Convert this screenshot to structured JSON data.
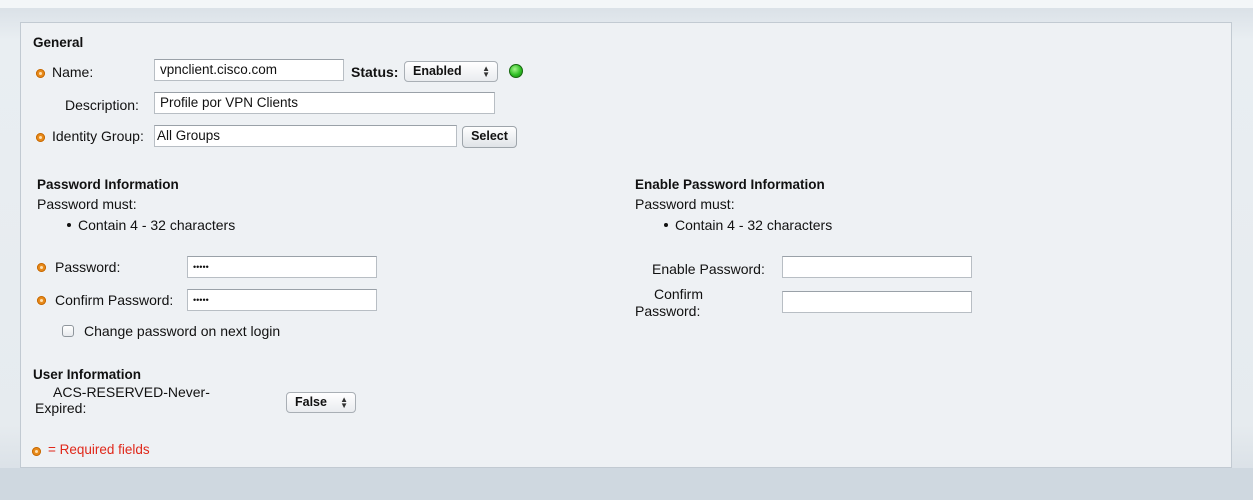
{
  "general": {
    "title": "General",
    "name_label": "Name:",
    "name_value": "vpnclient.cisco.com",
    "status_label": "Status:",
    "status_value": "Enabled",
    "description_label": "Description:",
    "description_value": "Profile por VPN Clients",
    "identity_group_label": "Identity Group:",
    "identity_group_value": "All Groups",
    "select_button": "Select"
  },
  "password_info": {
    "title": "Password Information",
    "must_label": "Password must:",
    "rule": "Contain 4 - 32 characters",
    "password_label": "Password:",
    "password_value": "•••••",
    "confirm_label": "Confirm Password:",
    "confirm_value": "•••••",
    "change_on_login_label": "Change password on next login"
  },
  "enable_password_info": {
    "title": "Enable Password Information",
    "must_label": "Password must:",
    "rule": "Contain 4 - 32 characters",
    "enable_password_label": "Enable Password:",
    "enable_password_value": "",
    "confirm_label_line1": "Confirm",
    "confirm_label_line2": "Password:",
    "confirm_value": ""
  },
  "user_info": {
    "title": "User Information",
    "attr_label_line1": "ACS-RESERVED-Never-",
    "attr_label_line2": "Expired:",
    "attr_value": "False"
  },
  "footer": {
    "required_note": "= Required fields"
  },
  "colors": {
    "required_marker": "#e88a1a",
    "required_text": "#e0281a",
    "status_enabled": "#2fbf25"
  }
}
